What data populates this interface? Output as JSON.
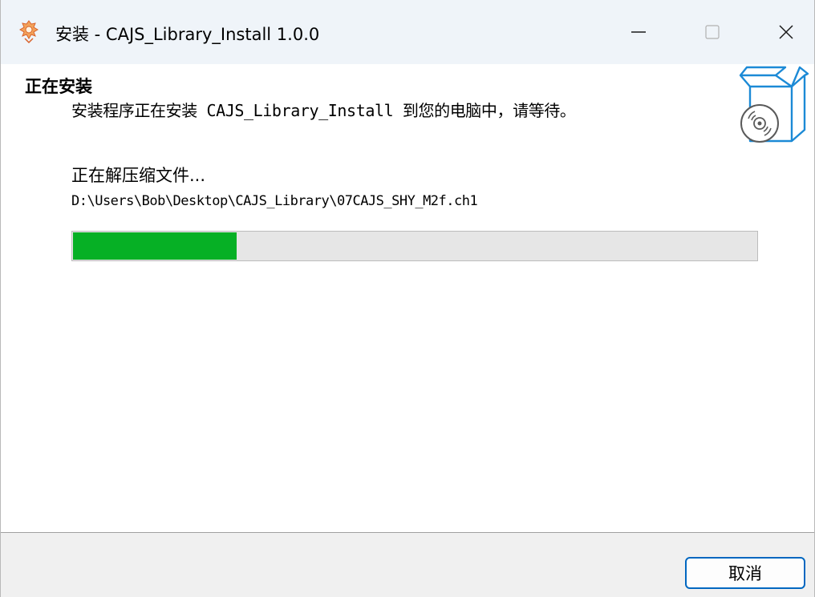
{
  "window": {
    "title": "安装 - CAJS_Library_Install 1.0.0",
    "app_icon": "installer-app-icon",
    "controls": {
      "minimize_icon": "minimize-icon",
      "maximize_icon": "maximize-icon",
      "close_icon": "close-icon"
    }
  },
  "header": {
    "title": "正在安装",
    "subtitle": "安装程序正在安装 CAJS_Library_Install 到您的电脑中，请等待。",
    "icon": "software-box-disc-icon"
  },
  "main": {
    "status": "正在解压缩文件...",
    "current_file": "D:\\Users\\Bob\\Desktop\\CAJS_Library\\07CAJS_SHY_M2f.ch1",
    "progress": 0.24,
    "progress_color": "#06B025"
  },
  "footer": {
    "cancel_label": "取消",
    "accent_color": "#0067C0"
  }
}
